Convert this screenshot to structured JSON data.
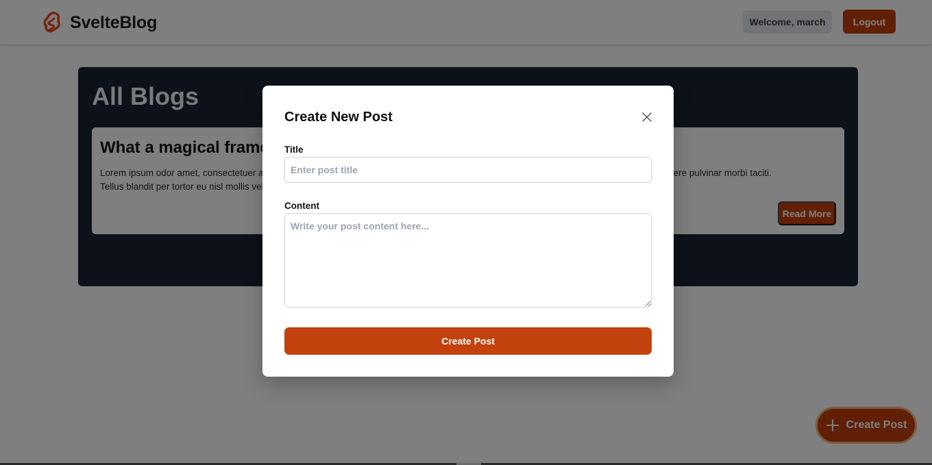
{
  "header": {
    "brand_name": "SvelteBlog",
    "logo_icon": "svelte-logo-icon",
    "welcome_text": "Welcome, march",
    "logout_label": "Logout"
  },
  "main": {
    "heading": "All Blogs",
    "posts": [
      {
        "title": "What a magical frame",
        "excerpt_lines": [
          "Lorem ipsum odor amet, consectetuer adipiscing elit. Facilisi feugiat tempus cras amet ultricies ut faucibus. Turpis mi fringilla dignissim posuere pulvinar morbi taciti.",
          "Tellus blandit per tortor eu nisl mollis vel."
        ],
        "read_more_label": "Read More"
      }
    ]
  },
  "fab": {
    "label": "Create Post",
    "icon": "plus-icon"
  },
  "modal": {
    "title": "Create New Post",
    "close_icon": "close-icon",
    "title_field_label": "Title",
    "title_placeholder": "Enter post title",
    "title_value": "",
    "content_field_label": "Content",
    "content_placeholder": "Write your post content here...",
    "content_value": "",
    "submit_label": "Create Post"
  },
  "colors": {
    "accent": "#c2410c",
    "panel_bg": "#1a2233",
    "overlay": "rgba(0,0,0,0.5)"
  }
}
